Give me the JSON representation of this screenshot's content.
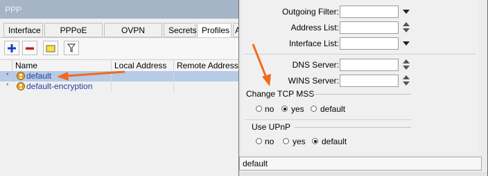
{
  "window": {
    "title": "PPP"
  },
  "tabs": [
    {
      "label": "Interface"
    },
    {
      "label": "PPPoE Servers"
    },
    {
      "label": "OVPN Servers"
    },
    {
      "label": "Secrets"
    },
    {
      "label": "Profiles"
    },
    {
      "label": "A"
    }
  ],
  "active_tab": "Profiles",
  "toolbar": {
    "add_icon": "plus-icon",
    "remove_icon": "minus-icon",
    "comment_icon": "note-icon",
    "filter_icon": "filter-icon"
  },
  "table": {
    "columns": [
      "Name",
      "Local Address",
      "Remote Address"
    ],
    "rows": [
      {
        "flag": "*",
        "name": "default",
        "selected": true
      },
      {
        "flag": "*",
        "name": "default-encryption",
        "selected": false
      }
    ]
  },
  "dialog": {
    "fields": [
      {
        "label": "Outgoing Filter:",
        "value": "",
        "control": "dropdown"
      },
      {
        "label": "Address List:",
        "value": "",
        "control": "updown"
      },
      {
        "label": "Interface List:",
        "value": "",
        "control": "dropdown"
      },
      {
        "label": "DNS Server:",
        "value": "",
        "control": "updown"
      },
      {
        "label": "WINS Server:",
        "value": "",
        "control": "updown"
      }
    ],
    "change_tcp_mss": {
      "title": "Change TCP MSS",
      "options": [
        "no",
        "yes",
        "default"
      ],
      "selected": "yes"
    },
    "use_upnp": {
      "title": "Use UPnP",
      "options": [
        "no",
        "yes",
        "default"
      ],
      "selected": "default"
    },
    "status": "default"
  },
  "colors": {
    "title_bar": "#a5b4c6",
    "selection": "#b6cbe6",
    "annotation_arrow": "#f06a1d",
    "profile_name": "#2b3ba0"
  }
}
